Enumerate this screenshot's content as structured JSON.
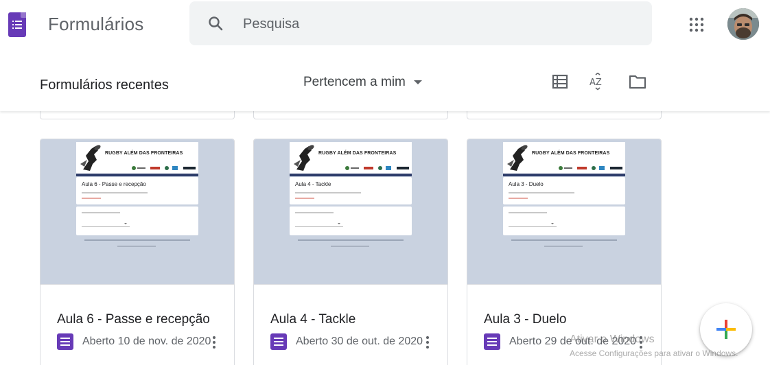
{
  "app": {
    "title": "Formulários",
    "brand_color": "#673ab7"
  },
  "search": {
    "placeholder": "Pesquisa"
  },
  "icons": {
    "logo": "google-forms-logo",
    "search": "search-icon",
    "apps": "apps-grid-icon",
    "list_view": "list-view-icon",
    "sort": "sort-az-icon",
    "folder": "folder-icon",
    "more": "more-vert-icon",
    "fab": "plus-icon"
  },
  "toolbar": {
    "title": "Formulários recentes",
    "owner_filter": "Pertencem a mim",
    "sort_icon_text": "AZ"
  },
  "cards": [
    {
      "title": "Aula 6 - Passe e recepção",
      "opened": "Aberto 10 de nov. de 2020",
      "thumb_header": "RUGBY ALÉM DAS FRONTEIRAS",
      "thumb_title": "Aula 6 - Passe e recepção"
    },
    {
      "title": "Aula 4 - Tackle",
      "opened": "Aberto 30 de out. de 2020",
      "thumb_header": "RUGBY ALÉM DAS FRONTEIRAS",
      "thumb_title": "Aula 4 - Tackle"
    },
    {
      "title": "Aula 3 - Duelo",
      "opened": "Aberto 29 de out. de 2020",
      "thumb_header": "RUGBY ALÉM DAS FRONTEIRAS",
      "thumb_title": "Aula 3 - Duelo"
    }
  ],
  "watermark": {
    "title": "Ativar o Windows",
    "subtitle": "Acesse Configurações para ativar o Windows."
  },
  "colors": {
    "fab_blue": "#4285f4",
    "fab_red": "#ea4335",
    "fab_yellow": "#fbbc04",
    "fab_green": "#34a853"
  }
}
